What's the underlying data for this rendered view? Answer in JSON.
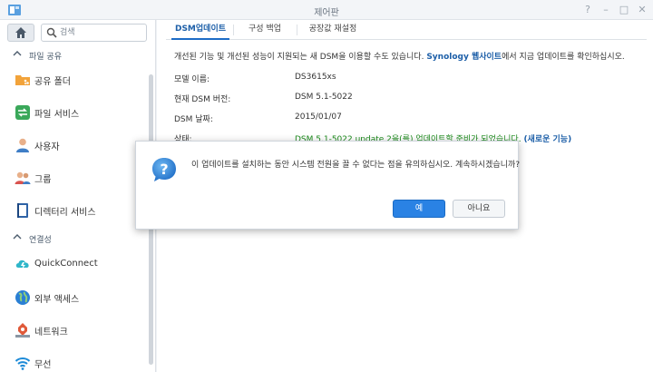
{
  "window": {
    "title": "제어판"
  },
  "colors": {
    "accent": "#1d6cc6",
    "status_green": "#1a8a1a",
    "primary_button": "#2a82e4"
  },
  "sidebar": {
    "search_placeholder": "검색",
    "sections": [
      {
        "label": "파일 공유"
      },
      {
        "label": "연결성"
      }
    ],
    "items": [
      {
        "label": "공유 폴더",
        "icon": "shared-folder-icon"
      },
      {
        "label": "파일 서비스",
        "icon": "file-services-icon"
      },
      {
        "label": "사용자",
        "icon": "user-icon"
      },
      {
        "label": "그룹",
        "icon": "group-icon"
      },
      {
        "label": "디렉터리 서비스",
        "icon": "directory-service-icon"
      },
      {
        "label": "QuickConnect",
        "icon": "quickconnect-icon"
      },
      {
        "label": "외부 액세스",
        "icon": "globe-icon"
      },
      {
        "label": "네트워크",
        "icon": "network-icon"
      },
      {
        "label": "무선",
        "icon": "wifi-icon"
      }
    ]
  },
  "tabs": [
    {
      "label": "DSM업데이트",
      "active": true
    },
    {
      "label": "구성 백업",
      "active": false
    },
    {
      "label": "공장값 재설정",
      "active": false
    }
  ],
  "main": {
    "description_pre": "개선된 기능 및 개선된 성능이 지원되는 새 DSM을 이용할 수도 있습니다. ",
    "description_link": "Synology 웹사이트",
    "description_post": "에서 지금 업데이트를 확인하십시오.",
    "rows": [
      {
        "label": "모델 이름:",
        "value": "DS3615xs"
      },
      {
        "label": "현재 DSM 버전:",
        "value": "DSM 5.1-5022"
      },
      {
        "label": "DSM 날짜:",
        "value": "2015/01/07"
      },
      {
        "label": "상태:",
        "value": "DSM 5.1-5022 update 2을(를) 업데이트할 준비가 되었습니다.",
        "link": "(새로운 기능)"
      }
    ]
  },
  "dialog": {
    "message": "이 업데이트를 설치하는 동안 시스템 전원을 끌 수 없다는 점을 유의하십시오. 계속하시겠습니까?",
    "yes_label": "예",
    "no_label": "아니요"
  }
}
